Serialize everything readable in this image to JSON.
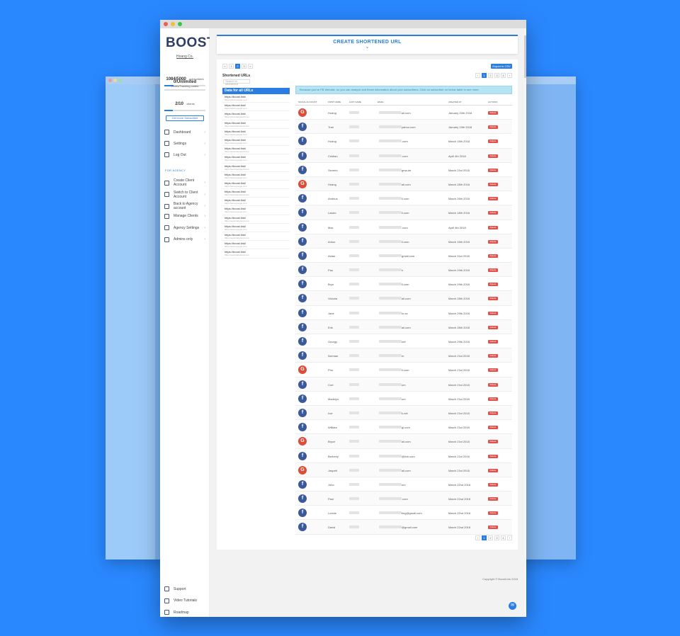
{
  "app": {
    "logo": "BOOST",
    "company": "Hoang Co.",
    "subscribers": {
      "count": "1084/5000",
      "label": "subscribers",
      "fill": 0.22
    },
    "pixels": {
      "count": "0/Unlimited",
      "label": "Pixels/Tracking codes",
      "fill": 0.0
    },
    "clients": {
      "count": "2/10",
      "label": "clients",
      "fill": 0.2
    },
    "get_more": "Get more Subscriber"
  },
  "nav": {
    "items": [
      {
        "label": "Dashboard",
        "icon": "dashboard-icon"
      },
      {
        "label": "Settings",
        "icon": "gear-icon"
      },
      {
        "label": "Log Out",
        "icon": "logout-icon"
      }
    ],
    "agency_label": "FOR AGENCY",
    "agency_items": [
      {
        "label": "Create Client Account",
        "icon": "plus-circle-icon"
      },
      {
        "label": "Switch to Client Account",
        "icon": "switch-icon"
      },
      {
        "label": "Back to Agency account",
        "icon": "back-icon"
      },
      {
        "label": "Manage Clients",
        "icon": "clients-icon"
      },
      {
        "label": "Agency Settings",
        "icon": "settings-icon"
      },
      {
        "label": "Admins only",
        "icon": "admin-icon"
      }
    ],
    "bottom": [
      {
        "label": "Support",
        "icon": "support-icon"
      },
      {
        "label": "Video Tutorials",
        "icon": "video-icon"
      },
      {
        "label": "Roadmap",
        "icon": "roadmap-icon"
      }
    ]
  },
  "create": {
    "title": "CREATE SHORTENED URL",
    "chevron": "⌄"
  },
  "pager_top": [
    "«",
    "1",
    "2",
    "3",
    "»"
  ],
  "pager_table": [
    "‹",
    "1",
    "2",
    "3",
    "4",
    "›"
  ],
  "export": "Export to CSV",
  "urls": {
    "title": "Shortened URLs",
    "search_placeholder": "Search in shortened",
    "header": "Data for all URLs",
    "items": [
      {
        "url": "https://boost.link/",
        "sub": "https://www.google.com"
      },
      {
        "url": "https://boost.link/",
        "sub": "https://www.google.com"
      },
      {
        "url": "https://boost.link/",
        "sub": "https://www.facebook.com"
      },
      {
        "url": "https://boost.link/",
        "sub": "https://www.facebook.com"
      },
      {
        "url": "https://boost.link/",
        "sub": "https://www.google.com"
      },
      {
        "url": "https://boost.link/",
        "sub": "https://www.google.com"
      },
      {
        "url": "https://boost.link/",
        "sub": "https://www.facebook.com"
      },
      {
        "url": "https://boost.link/",
        "sub": "https://www.google.com"
      },
      {
        "url": "https://boost.link/",
        "sub": "https://www.facebook.com"
      },
      {
        "url": "https://boost.link/",
        "sub": "https://www.google.com"
      },
      {
        "url": "https://boost.link/",
        "sub": "https://www.google.com"
      },
      {
        "url": "https://boost.link/",
        "sub": "https://www.facebook.com"
      },
      {
        "url": "https://boost.link/",
        "sub": "https://www.google.com"
      },
      {
        "url": "https://boost.link/",
        "sub": "https://www.google.com"
      },
      {
        "url": "https://boost.link/",
        "sub": "https://www.facebook.com"
      },
      {
        "url": "https://boost.link/",
        "sub": "https://www.google.com"
      },
      {
        "url": "https://boost.link/",
        "sub": "https://www.facebook.com"
      },
      {
        "url": "https://boost.link/",
        "sub": "https://www.google.com"
      },
      {
        "url": "https://boost.link/",
        "sub": "https://www.facebook.com"
      }
    ]
  },
  "notice": "Because you've FB Website, so you can analyze and those information about your subscribers. Click on subscriber on below table to see more.",
  "table": {
    "headers": [
      "SOCIAL ACCOUNT",
      "FIRST NAME",
      "LAST NAME",
      "EMAIL",
      "CREATED AT",
      "ACTIONS"
    ],
    "delete_label": "Delete",
    "rows": [
      {
        "type": "G",
        "first": "Hoang",
        "email": "ail.com",
        "date": "January 20th 2018"
      },
      {
        "type": "f",
        "first": "Tran",
        "email": "yahoo.com",
        "date": "January 19th 2018"
      },
      {
        "type": "f",
        "first": "Hoang",
        "email": ".com",
        "date": "March 15th 2018"
      },
      {
        "type": "f",
        "first": "Cristian",
        "email": ".com",
        "date": "April 4th 2018"
      },
      {
        "type": "f",
        "first": "Severin",
        "email": "gma.de",
        "date": "March 21st 2018"
      },
      {
        "type": "G",
        "first": "Hoang",
        "email": "ail.com",
        "date": "March 28th 2018"
      },
      {
        "type": "f",
        "first": "Andrius",
        "email": "il.com",
        "date": "March 26th 2018"
      },
      {
        "type": "f",
        "first": "Laszlo",
        "email": "il.com",
        "date": "March 18th 2018"
      },
      {
        "type": "f",
        "first": "Max",
        "email": ".com",
        "date": "April 4th 2018"
      },
      {
        "type": "f",
        "first": "Ankur",
        "email": "il.com",
        "date": "March 16th 2018"
      },
      {
        "type": "f",
        "first": "Aidan",
        "email": "gmail.com",
        "date": "March 31st 2018"
      },
      {
        "type": "f",
        "first": "Pau",
        "email": "n",
        "date": "March 29th 2018"
      },
      {
        "type": "f",
        "first": "Bryn",
        "email": "il.com",
        "date": "March 29th 2018"
      },
      {
        "type": "f",
        "first": "Victoria",
        "email": "ail.com",
        "date": "March 28th 2018"
      },
      {
        "type": "f",
        "first": "Jane",
        "email": "io.ca",
        "date": "March 29th 2018"
      },
      {
        "type": "f",
        "first": "Erik",
        "email": "ail.com",
        "date": "March 28th 2018"
      },
      {
        "type": "f",
        "first": "Georgy",
        "email": "net",
        "date": "March 29th 2018"
      },
      {
        "type": "f",
        "first": "Norman",
        "email": "m",
        "date": "March 21st 2018"
      },
      {
        "type": "G",
        "first": "Phu",
        "email": "il.com",
        "date": "March 21st 2018"
      },
      {
        "type": "f",
        "first": "Curt",
        "email": "om",
        "date": "March 21st 2018"
      },
      {
        "type": "f",
        "first": "Madelyn",
        "email": "om",
        "date": "March 21st 2018"
      },
      {
        "type": "f",
        "first": "Ivor",
        "email": "k.net",
        "date": "March 21st 2018"
      },
      {
        "type": "f",
        "first": "William",
        "email": "gl.com",
        "date": "March 21st 2018"
      },
      {
        "type": "G",
        "first": "Bryce",
        "email": "ail.com",
        "date": "March 21st 2018"
      },
      {
        "type": "f",
        "first": "Berberly",
        "email": "@live.com",
        "date": "March 21st 2018"
      },
      {
        "type": "G",
        "first": "Jaspett",
        "email": "ail.com",
        "date": "March 21st 2018"
      },
      {
        "type": "f",
        "first": "John",
        "email": "om",
        "date": "March 22nd 2018"
      },
      {
        "type": "f",
        "first": "Paul",
        "email": ".com",
        "date": "March 22nd 2018"
      },
      {
        "type": "f",
        "first": "Lonnie",
        "email": "ting@gmail.com",
        "date": "March 22nd 2018"
      },
      {
        "type": "f",
        "first": "David",
        "email": "@gmail.com",
        "date": "March 22nd 2018"
      }
    ]
  },
  "copyright": "Copyright © BoostLink 2018",
  "colors": {
    "accent": "#2a7de1",
    "facebook": "#3b5a9a",
    "google": "#dd4b39",
    "delete": "#e3504a"
  }
}
